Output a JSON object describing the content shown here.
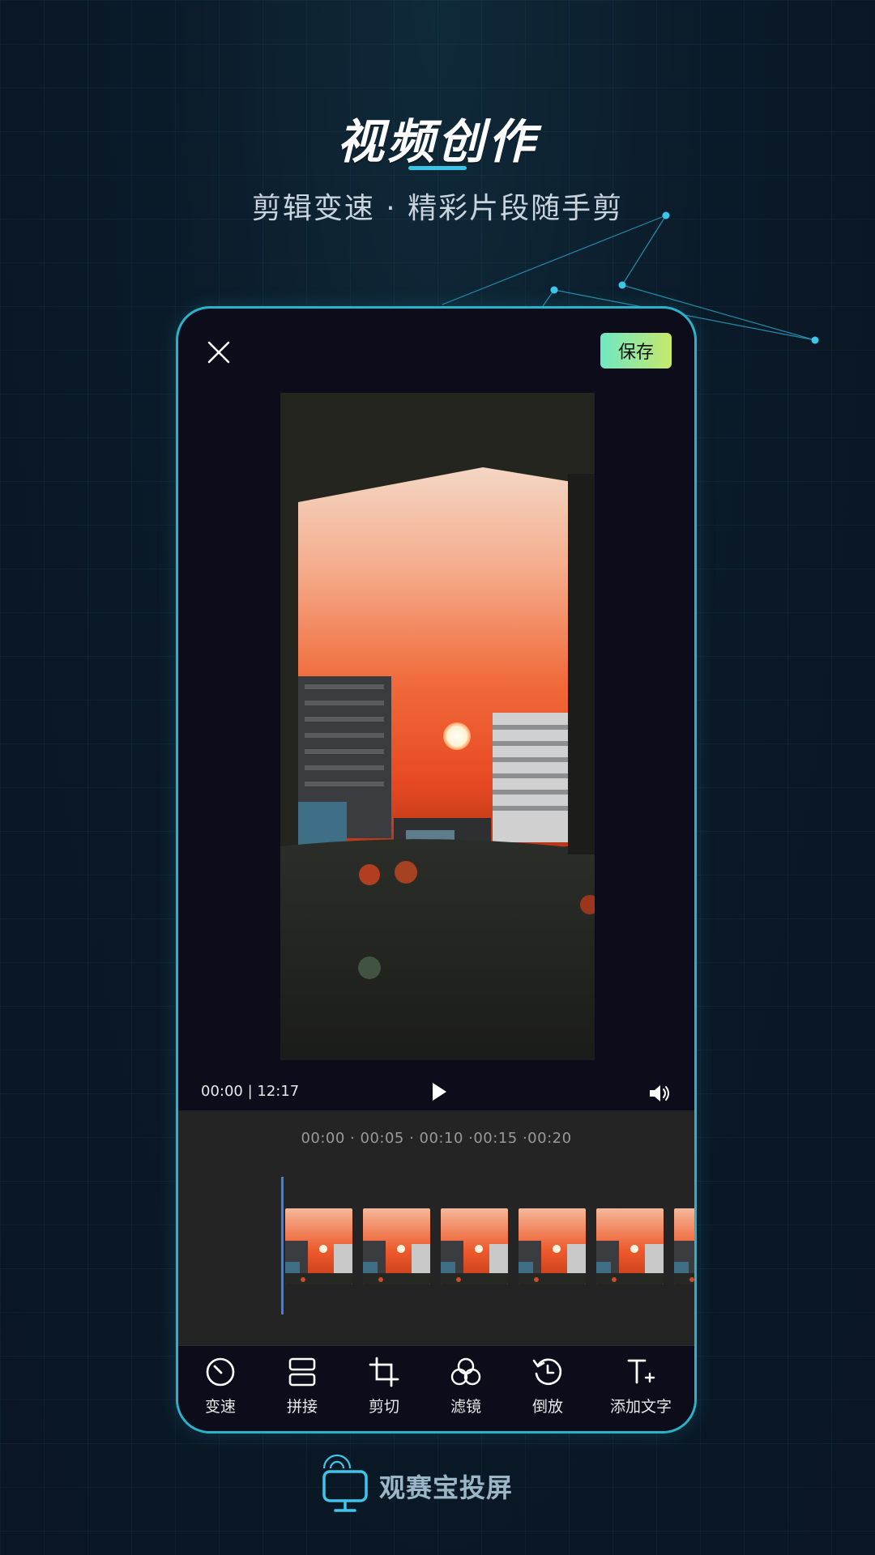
{
  "promo": {
    "headline": "视频创作",
    "subline": "剪辑变速 · 精彩片段随手剪"
  },
  "editor": {
    "save_label": "保存",
    "time_display": "00:00 | 12:17",
    "ruler": "00:00  ·  00:05  ·  00:10  ·00:15  ·00:20",
    "tools": [
      {
        "label": "变速",
        "icon": "speed-gauge-icon"
      },
      {
        "label": "拼接",
        "icon": "splice-icon"
      },
      {
        "label": "剪切",
        "icon": "crop-icon"
      },
      {
        "label": "滤镜",
        "icon": "filter-icon"
      },
      {
        "label": "倒放",
        "icon": "reverse-icon"
      },
      {
        "label": "添加文字",
        "icon": "add-text-icon"
      }
    ]
  },
  "brand": {
    "name": "观赛宝投屏"
  },
  "colors": {
    "accent": "#2ab3c8",
    "playhead": "#3c7df0",
    "save_gradient_start": "#6ee8c4",
    "save_gradient_end": "#c8e86a"
  }
}
